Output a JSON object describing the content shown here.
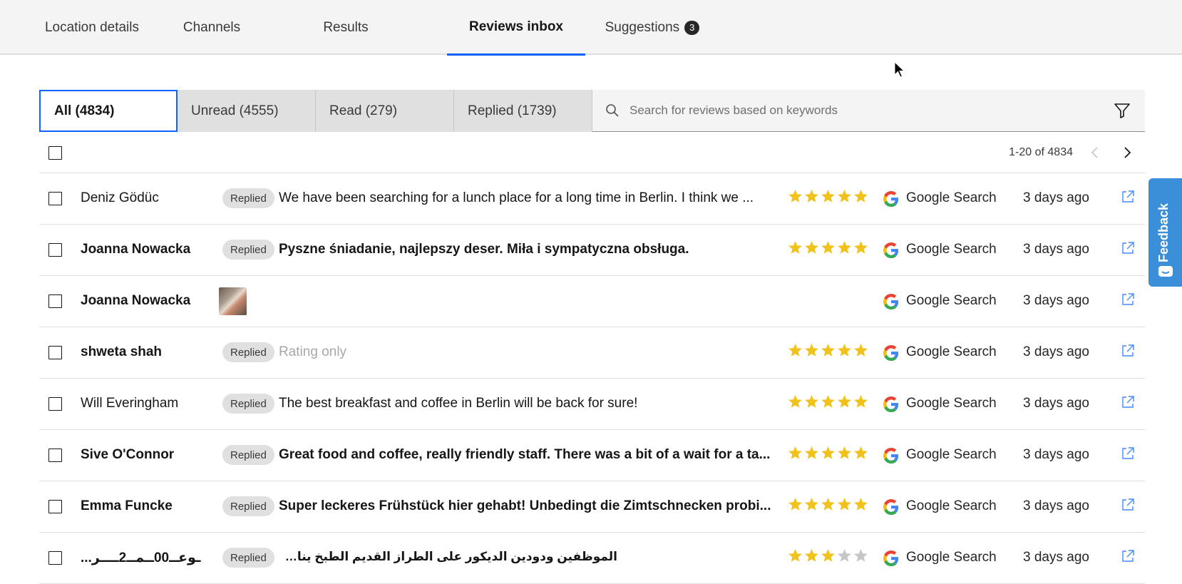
{
  "tabs": [
    {
      "label": "Location details"
    },
    {
      "label": "Channels"
    },
    {
      "label": "Results"
    },
    {
      "label": "Reviews inbox"
    },
    {
      "label": "Suggestions",
      "badge": "3"
    }
  ],
  "filters": [
    {
      "label": "All (4834)"
    },
    {
      "label": "Unread (4555)"
    },
    {
      "label": "Read (279)"
    },
    {
      "label": "Replied (1739)"
    }
  ],
  "search": {
    "placeholder": "Search for reviews based on keywords"
  },
  "pagination": {
    "text": "1-20 of 4834"
  },
  "reviews": [
    {
      "name": "Deniz Gödüc",
      "tag": "Replied",
      "text": "We have been searching for a lunch place for a long time in Berlin. I think we ...",
      "rating": 5,
      "source": "Google Search",
      "date": "3 days ago"
    },
    {
      "name": "Joanna Nowacka",
      "tag": "Replied",
      "text": "Pyszne śniadanie, najlepszy deser. Miła i sympatyczna obsługa.",
      "rating": 5,
      "source": "Google Search",
      "date": "3 days ago"
    },
    {
      "name": "Joanna Nowacka",
      "tag": "",
      "text": "",
      "rating": 0,
      "source": "Google Search",
      "date": "3 days ago"
    },
    {
      "name": "shweta shah",
      "tag": "Replied",
      "text": "Rating only",
      "rating": 5,
      "source": "Google Search",
      "date": "3 days ago"
    },
    {
      "name": "Will Everingham",
      "tag": "Replied",
      "text": "The best breakfast and coffee in Berlin will be back for sure!",
      "rating": 5,
      "source": "Google Search",
      "date": "3 days ago"
    },
    {
      "name": "Sive O'Connor",
      "tag": "Replied",
      "text": "Great food and coffee, really friendly staff. There was a bit of a wait for a ta...",
      "rating": 5,
      "source": "Google Search",
      "date": "3 days ago"
    },
    {
      "name": "Emma Funcke",
      "tag": "Replied",
      "text": "Super leckeres Frühstück hier gehabt! Unbedingt die Zimtschnecken probi...",
      "rating": 5,
      "source": "Google Search",
      "date": "3 days ago"
    },
    {
      "name": "...ـوعــ00ــمــ2ــــر",
      "tag": "Replied",
      "text": "الموظفين ودودين الديكور على الطراز القديم الطبخ يناسب الصحيين اكثر",
      "rating": 3,
      "source": "Google Search",
      "date": "3 days ago"
    }
  ],
  "feedback": {
    "label": "Feedback"
  },
  "colors": {
    "accent": "#0f62fe",
    "star": "#f1c21b",
    "star_empty": "#c6c6c6",
    "feedback": "#3a8fd8"
  }
}
